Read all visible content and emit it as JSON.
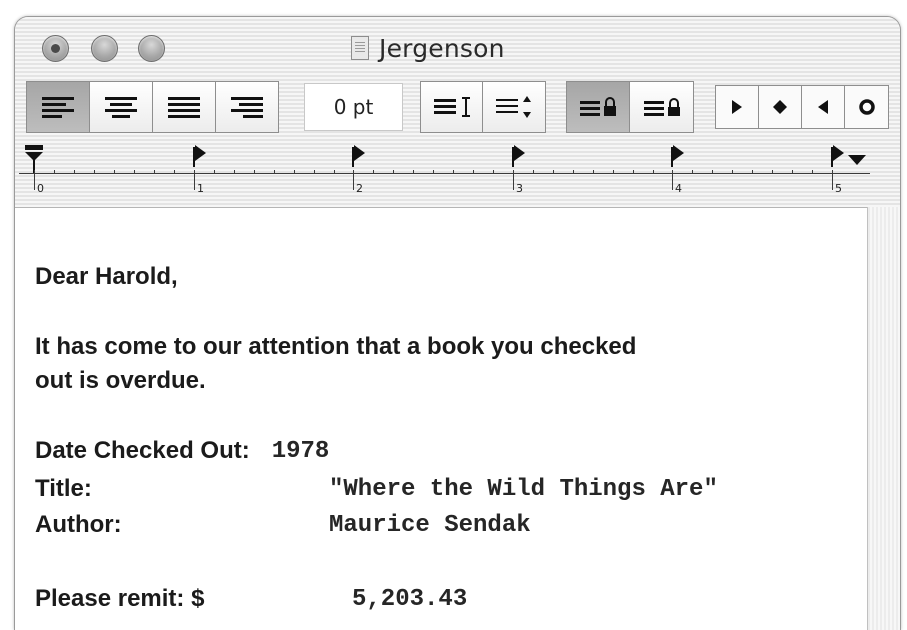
{
  "window": {
    "title": "Jergenson"
  },
  "toolbar": {
    "alignment": [
      "align-left",
      "align-center",
      "align-justify",
      "align-right"
    ],
    "spacing_value": "0 pt",
    "spacing_controls": [
      "line-height-icon",
      "paragraph-spacing-icon"
    ],
    "lock_controls": [
      "line-height-lock-icon",
      "spacing-lock-icon"
    ],
    "tab_types": [
      "left-tab-icon",
      "center-tab-icon",
      "right-tab-icon",
      "decimal-tab-icon"
    ]
  },
  "ruler": {
    "labels": [
      "0",
      "1",
      "2",
      "3",
      "4",
      "5"
    ]
  },
  "document": {
    "greeting": "Dear Harold,",
    "body_line1": "It has come to our attention that a book you checked",
    "body_line2": "out is overdue.",
    "date_label": "Date Checked Out:",
    "date_value": "1978",
    "title_label": "Title:",
    "title_value": "\"Where the Wild Things Are\"",
    "author_label": "Author:",
    "author_value": "Maurice Sendak",
    "remit_label": "Please remit: $",
    "remit_value": "5,203.43"
  }
}
